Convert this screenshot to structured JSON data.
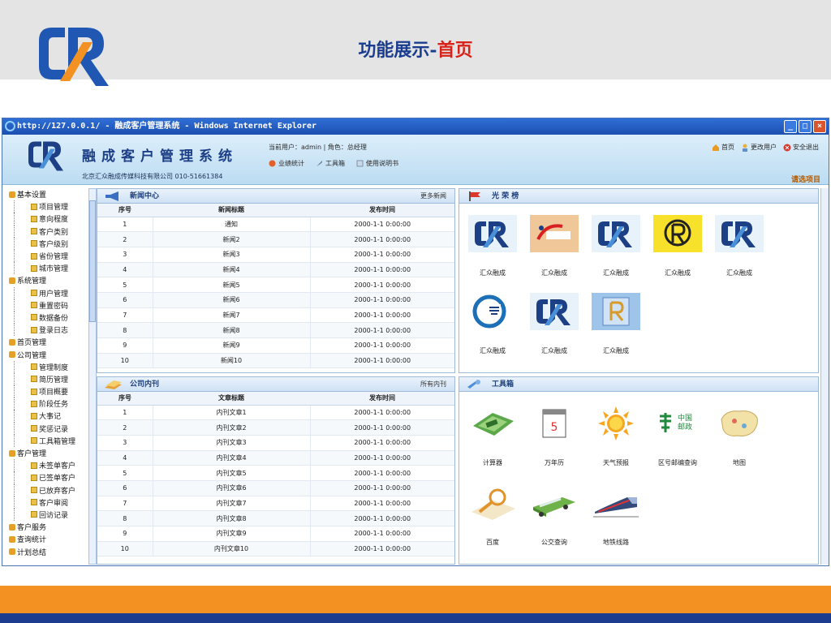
{
  "slide": {
    "title_part1": "功能展示-",
    "title_part2": "首页"
  },
  "browser": {
    "title": "http://127.0.0.1/ - 融成客户管理系统 - Windows Internet Explorer"
  },
  "app": {
    "name": "融成客户管理系统",
    "company": "北京汇众融成传媒科技有限公司  010-51661384",
    "user_info": "当前用户：admin  | 角色：总经理",
    "quick_links": [
      "业绩统计",
      "工具箱",
      "使用说明书"
    ],
    "top_links": [
      "首页",
      "更改用户",
      "安全退出"
    ],
    "select_item": "请选项目"
  },
  "tree": [
    {
      "label": "基本设置",
      "group": true
    },
    {
      "label": "项目管理"
    },
    {
      "label": "意向程度"
    },
    {
      "label": "客户类别"
    },
    {
      "label": "客户级别"
    },
    {
      "label": "省份管理"
    },
    {
      "label": "城市管理"
    },
    {
      "label": "系统管理",
      "group": true
    },
    {
      "label": "用户管理"
    },
    {
      "label": "重置密码"
    },
    {
      "label": "数据备份"
    },
    {
      "label": "登录日志"
    },
    {
      "label": "首页管理",
      "group": true
    },
    {
      "label": "公司管理",
      "group": true
    },
    {
      "label": "管理制度"
    },
    {
      "label": "简历管理"
    },
    {
      "label": "项目概要"
    },
    {
      "label": "阶段任务"
    },
    {
      "label": "大事记"
    },
    {
      "label": "奖惩记录"
    },
    {
      "label": "工具箱管理"
    },
    {
      "label": "客户管理",
      "group": true
    },
    {
      "label": "未签单客户"
    },
    {
      "label": "已签单客户"
    },
    {
      "label": "已放弃客户"
    },
    {
      "label": "客户审阅"
    },
    {
      "label": "回访记录"
    },
    {
      "label": "客户服务",
      "group": true
    },
    {
      "label": "查询统计",
      "group": true
    },
    {
      "label": "计划总结",
      "group": true
    }
  ],
  "news": {
    "title": "新闻中心",
    "more": "更多新闻",
    "columns": [
      "序号",
      "新闻标题",
      "发布时间"
    ],
    "rows": [
      [
        "1",
        "通知",
        "2000-1-1 0:00:00"
      ],
      [
        "2",
        "新闻2",
        "2000-1-1 0:00:00"
      ],
      [
        "3",
        "新闻3",
        "2000-1-1 0:00:00"
      ],
      [
        "4",
        "新闻4",
        "2000-1-1 0:00:00"
      ],
      [
        "5",
        "新闻5",
        "2000-1-1 0:00:00"
      ],
      [
        "6",
        "新闻6",
        "2000-1-1 0:00:00"
      ],
      [
        "7",
        "新闻7",
        "2000-1-1 0:00:00"
      ],
      [
        "8",
        "新闻8",
        "2000-1-1 0:00:00"
      ],
      [
        "9",
        "新闻9",
        "2000-1-1 0:00:00"
      ],
      [
        "10",
        "新闻10",
        "2000-1-1 0:00:00"
      ]
    ]
  },
  "journal": {
    "title": "公司内刊",
    "more": "所有内刊",
    "columns": [
      "序号",
      "文章标题",
      "发布时间"
    ],
    "rows": [
      [
        "1",
        "内刊文章1",
        "2000-1-1 0:00:00"
      ],
      [
        "2",
        "内刊文章2",
        "2000-1-1 0:00:00"
      ],
      [
        "3",
        "内刊文章3",
        "2000-1-1 0:00:00"
      ],
      [
        "4",
        "内刊文章4",
        "2000-1-1 0:00:00"
      ],
      [
        "5",
        "内刊文章5",
        "2000-1-1 0:00:00"
      ],
      [
        "6",
        "内刊文章6",
        "2000-1-1 0:00:00"
      ],
      [
        "7",
        "内刊文章7",
        "2000-1-1 0:00:00"
      ],
      [
        "8",
        "内刊文章8",
        "2000-1-1 0:00:00"
      ],
      [
        "9",
        "内刊文章9",
        "2000-1-1 0:00:00"
      ],
      [
        "10",
        "内刊文章10",
        "2000-1-1 0:00:00"
      ]
    ]
  },
  "honor": {
    "title": "光 荣 榜",
    "items": [
      {
        "label": "汇众融成"
      },
      {
        "label": "汇众融成"
      },
      {
        "label": "汇众融成"
      },
      {
        "label": "汇众融成"
      },
      {
        "label": "汇众融成"
      },
      {
        "label": "汇众融成"
      },
      {
        "label": "汇众融成"
      },
      {
        "label": "汇众融成"
      }
    ]
  },
  "toolbox": {
    "title": "工具箱",
    "items": [
      {
        "label": "计算器",
        "icon": "calculator-icon"
      },
      {
        "label": "万年历",
        "icon": "calendar-icon"
      },
      {
        "label": "天气预报",
        "icon": "sun-icon"
      },
      {
        "label": "区号邮编查询",
        "icon": "china-post-icon",
        "icon_text": "中国\n邮政"
      },
      {
        "label": "地图",
        "icon": "map-icon"
      },
      {
        "label": "百度",
        "icon": "magnifier-icon"
      },
      {
        "label": "公交查询",
        "icon": "bus-icon"
      },
      {
        "label": "地铁线路",
        "icon": "train-icon"
      }
    ]
  },
  "colors": {
    "orange": "#f39222",
    "navy": "#1c3c8f",
    "title_blue": "#1a3d8f",
    "title_red": "#d8231b"
  }
}
